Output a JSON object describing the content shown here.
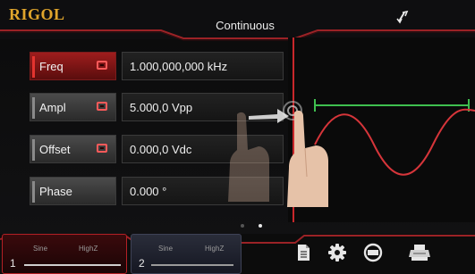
{
  "header": {
    "brand": "RIGOL",
    "mode": "Continuous"
  },
  "params": [
    {
      "label": "Freq",
      "value": "1.000,000,000 kHz",
      "active": true,
      "linked": true
    },
    {
      "label": "Ampl",
      "value": "5.000,0 Vpp",
      "active": false,
      "linked": true
    },
    {
      "label": "Offset",
      "value": "0.000,0 Vdc",
      "active": false,
      "linked": true
    },
    {
      "label": "Phase",
      "value": "0.000 °",
      "active": false,
      "linked": false
    }
  ],
  "pager": {
    "current": 2,
    "total": 2
  },
  "channels": [
    {
      "number": "1",
      "wave": "Sine",
      "load": "HighZ",
      "active": true
    },
    {
      "number": "2",
      "wave": "Sine",
      "load": "HighZ",
      "active": false
    }
  ],
  "toolbar": {
    "icons": [
      "document-icon",
      "gear-icon",
      "counter-icon",
      "printer-icon"
    ]
  },
  "colors": {
    "accent": "#c8272b",
    "brand": "#e0a52c",
    "waveform": "#d6353a",
    "period_marker": "#3fbf4f"
  }
}
